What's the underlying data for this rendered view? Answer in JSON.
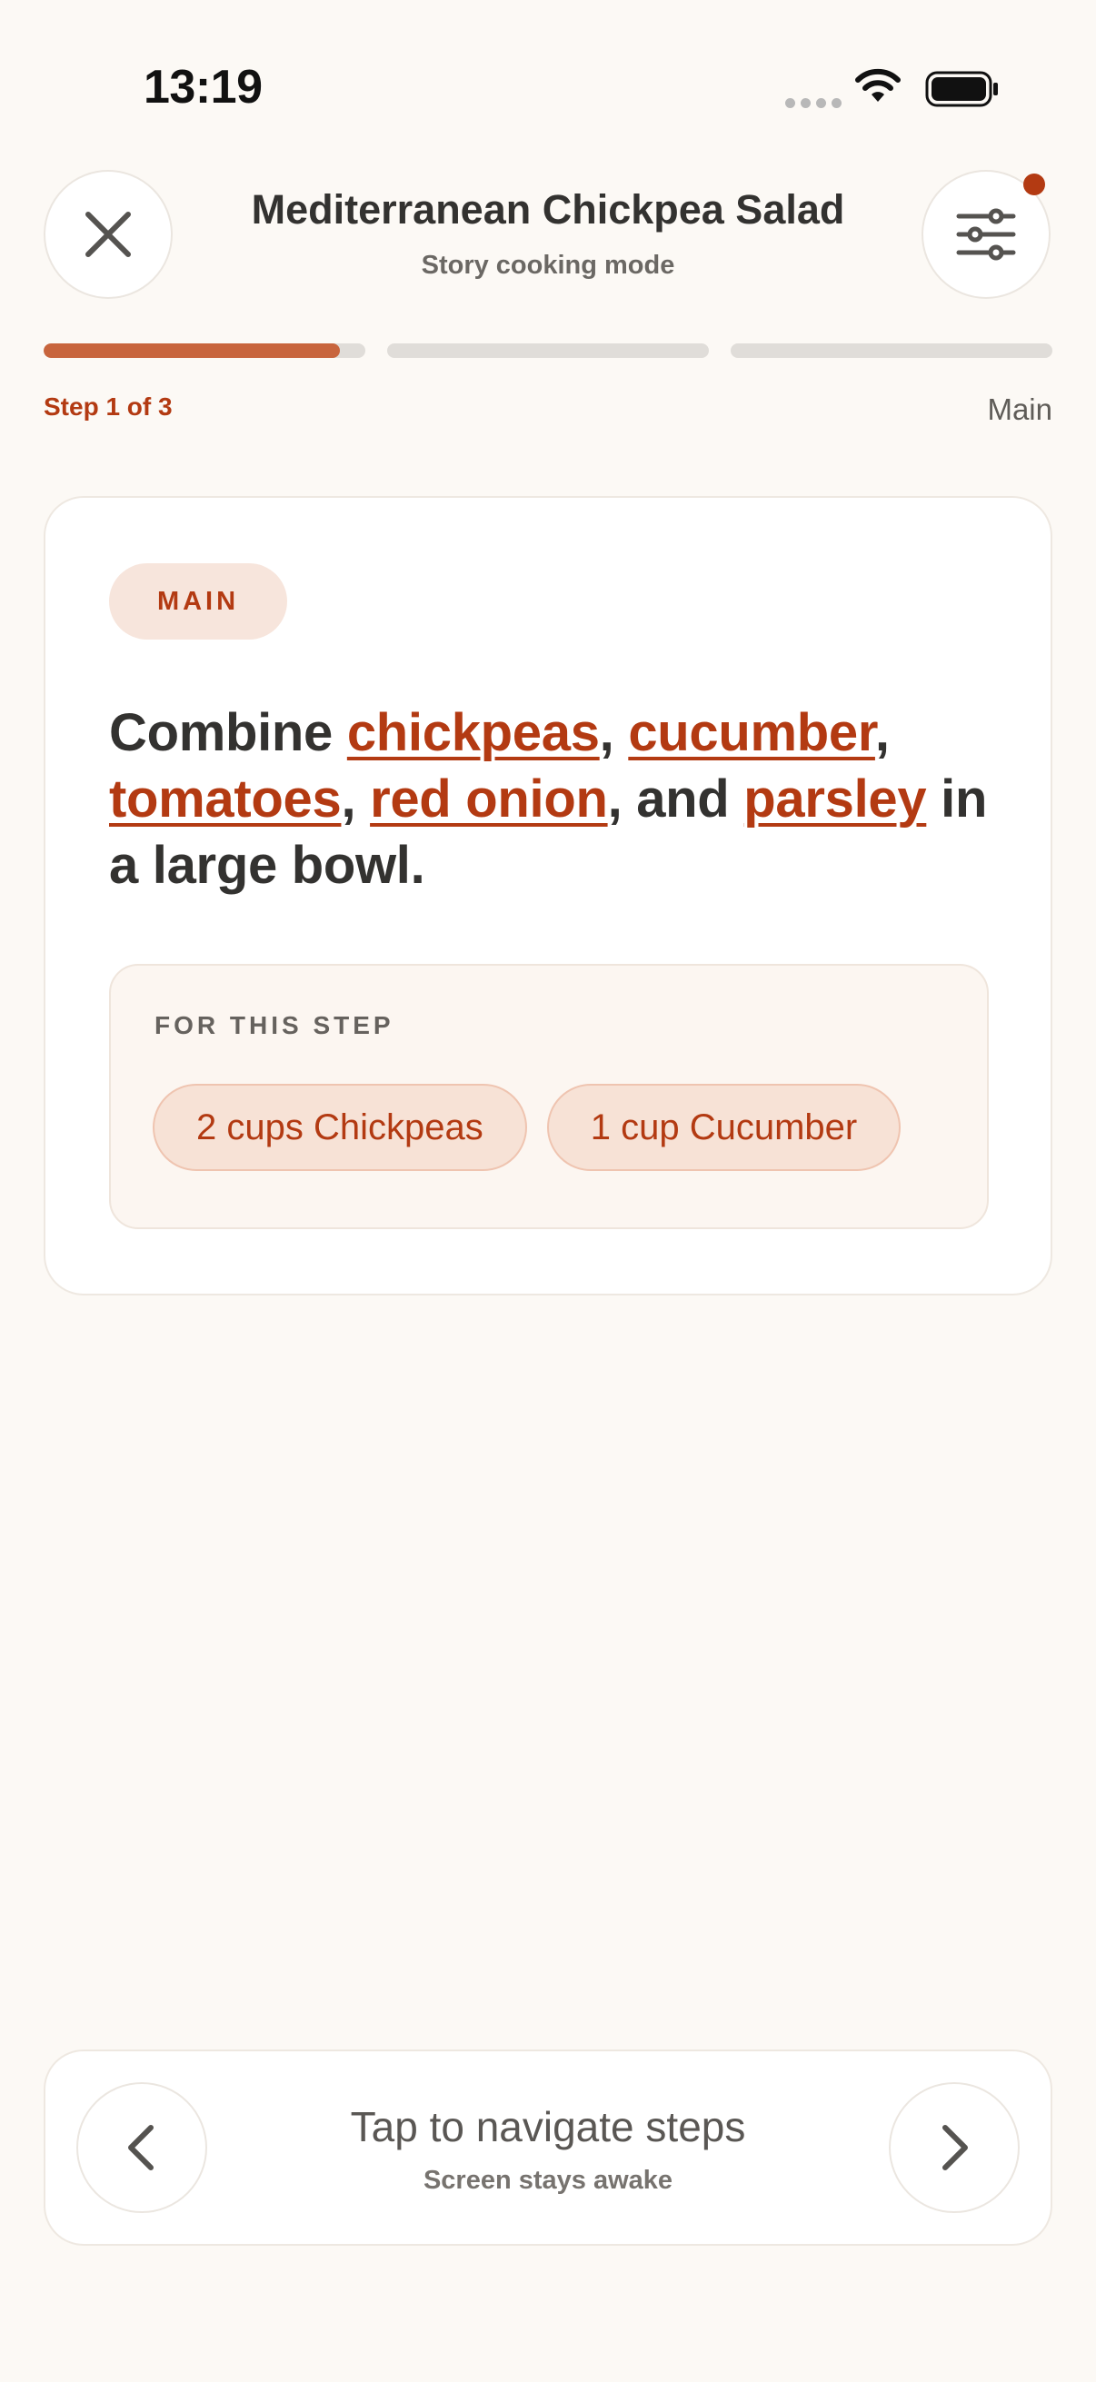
{
  "status_bar": {
    "time": "13:19"
  },
  "header": {
    "title": "Mediterranean Chickpea Salad",
    "subtitle": "Story cooking mode",
    "close_icon": "close-icon",
    "settings_icon": "sliders-icon",
    "has_notification": true
  },
  "progress": {
    "step_label": "Step 1 of 3",
    "section_label": "Main",
    "segments": [
      {
        "fill": 0.92
      },
      {
        "fill": 0
      },
      {
        "fill": 0
      }
    ]
  },
  "step": {
    "tag": "MAIN",
    "instruction": {
      "intro": "Combine ",
      "ingredients": [
        "chickpeas",
        "cucumber",
        "tomatoes",
        "red onion",
        "parsley"
      ],
      "sep1": ", ",
      "sep2": ", ",
      "sep3": ", ",
      "sep4": ", and ",
      "outro": " in a large bowl."
    },
    "for_this_step": {
      "title": "FOR THIS STEP",
      "chips": [
        "2 cups Chickpeas",
        "1 cup Cucumber"
      ]
    }
  },
  "bottom_nav": {
    "main_text": "Tap to navigate steps",
    "sub_text": "Screen stays awake",
    "prev_icon": "chevron-left-icon",
    "next_icon": "chevron-right-icon"
  },
  "colors": {
    "accent": "#b33a12",
    "progress_fill": "#c8653d",
    "background": "#fcf9f5"
  }
}
